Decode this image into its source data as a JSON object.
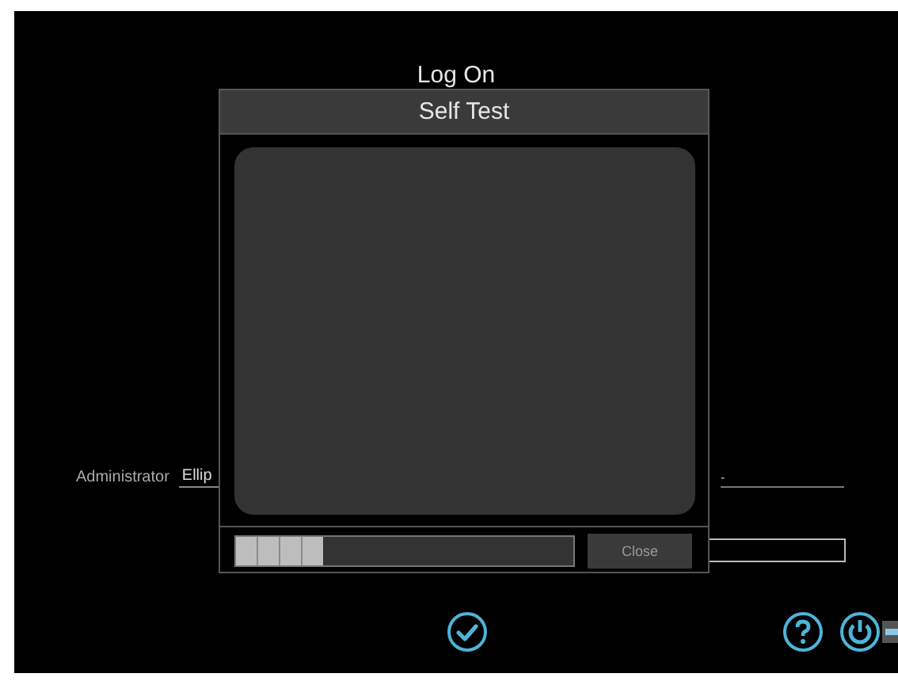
{
  "screen": {
    "title": "Log On",
    "user_label": "Administrator",
    "user_value": "Ellip",
    "field_2_value": "-"
  },
  "dialog": {
    "title": "Self Test",
    "progress": {
      "level": 0.26
    },
    "close_button": "Close"
  }
}
